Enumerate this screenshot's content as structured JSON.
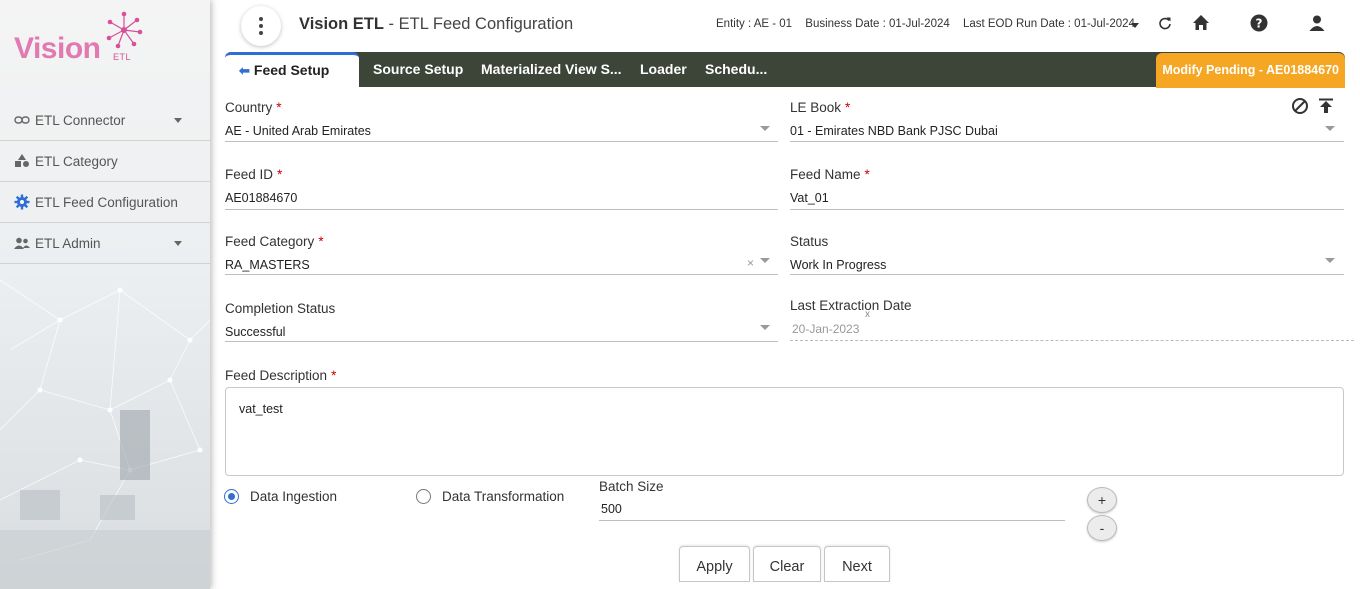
{
  "sidebar": {
    "logo_text": "Vision",
    "logo_sub": "ETL",
    "items": [
      {
        "label": "ETL Connector",
        "icon": "link-icon"
      },
      {
        "label": "ETL Category",
        "icon": "shapes-icon"
      },
      {
        "label": "ETL Feed Configuration",
        "icon": "gear-icon"
      },
      {
        "label": "ETL Admin",
        "icon": "users-icon"
      }
    ]
  },
  "header": {
    "app_name": "Vision ETL",
    "page_name": " - ETL Feed Configuration",
    "entity": "Entity : AE - 01",
    "business_date": "Business Date : 01-Jul-2024",
    "eod_date": "Last EOD Run Date : 01-Jul-2024"
  },
  "tabs": {
    "active": "Feed Setup",
    "items": [
      "Source Setup",
      "Materialized View S...",
      "Loader",
      "Schedu..."
    ],
    "pending": "Modify Pending - AE01884670"
  },
  "form": {
    "country": {
      "label": "Country",
      "value": "AE - United Arab Emirates"
    },
    "le_book": {
      "label": "LE Book",
      "value": "01 - Emirates NBD Bank PJSC Dubai"
    },
    "feed_id": {
      "label": "Feed ID",
      "value": "AE01884670"
    },
    "feed_name": {
      "label": "Feed Name",
      "value": "Vat_01"
    },
    "feed_category": {
      "label": "Feed Category",
      "value": "RA_MASTERS",
      "clear": "×"
    },
    "status": {
      "label": "Status",
      "value": "Work In Progress"
    },
    "completion_status": {
      "label": "Completion Status",
      "value": "Successful"
    },
    "last_extraction": {
      "label": "Last Extraction Date",
      "value": "20-Jan-2023",
      "clear": "x"
    },
    "description": {
      "label": "Feed Description",
      "value": "vat_test"
    },
    "data_ingestion": "Data Ingestion",
    "data_transformation": "Data Transformation",
    "batch_size": {
      "label": "Batch Size",
      "value": "500"
    },
    "plus": "+",
    "minus": "-",
    "required_mark": "*"
  },
  "buttons": {
    "apply": "Apply",
    "clear": "Clear",
    "next": "Next"
  },
  "colors": {
    "accent": "#2f6fd1",
    "tabbar": "#3d4438",
    "pending": "#f5a623",
    "logo": "#e07ab0"
  }
}
